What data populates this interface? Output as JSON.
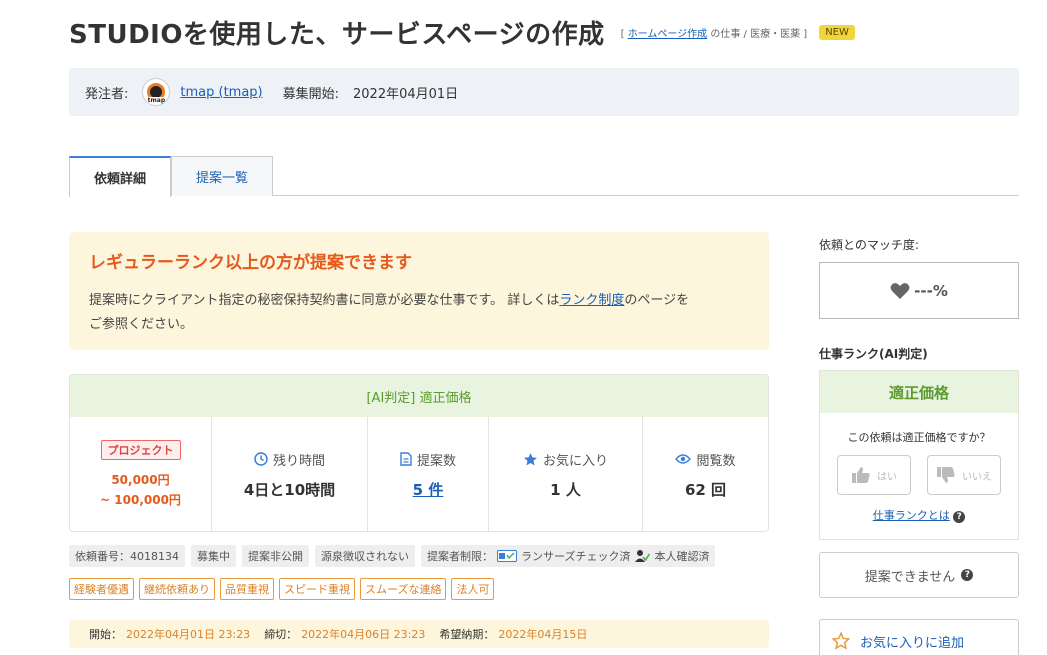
{
  "header": {
    "title": "STUDIOを使用した、サービスページの作成",
    "crumb_open": "[",
    "crumb_link": "ホームページ作成",
    "crumb_rest": "の仕事 / 医療・医薬",
    "crumb_close": "]",
    "new_badge": "NEW"
  },
  "client": {
    "label": "発注者:",
    "name": "tmap (tmap)",
    "avatar_text": "tmap",
    "recruit_label": "募集開始:",
    "recruit_date": "2022年04月01日"
  },
  "tabs": [
    {
      "label": "依頼詳細",
      "active": true
    },
    {
      "label": "提案一覧",
      "active": false
    }
  ],
  "notice": {
    "title": "レギュラーランク以上の方が提案できます",
    "body_before": "提案時にクライアント指定の秘密保持契約書に同意が必要な仕事です。 詳しくは",
    "link": "ランク制度",
    "body_after": "のページを",
    "body_line2": "ご参照ください。"
  },
  "stats": {
    "header": "[AI判定] 適正価格",
    "project_badge": "プロジェクト",
    "price_min": "50,000円",
    "price_max": "~ 100,000円",
    "remaining_label": "残り時間",
    "remaining_value": "4日と10時間",
    "proposals_label": "提案数",
    "proposals_value": "5 件",
    "favorites_label": "お気に入り",
    "favorites_value": "1 人",
    "views_label": "閲覧数",
    "views_value": "62 回"
  },
  "tags_info": {
    "job_number": "依頼番号：4018134",
    "status": "募集中",
    "proposal_visibility": "提案非公開",
    "withholding": "源泉徴収されない",
    "restriction_label": "提案者制限：",
    "restriction_check": "ランサーズチェック済",
    "restriction_id": "本人確認済"
  },
  "tags_pref": [
    "経験者優遇",
    "継続依頼あり",
    "品質重視",
    "スピード重視",
    "スムーズな連絡",
    "法人可"
  ],
  "dates": {
    "start_label": "開始：",
    "start_value": "2022年04月01日 23:23",
    "end_label": "締切：",
    "end_value": "2022年04月06日 23:23",
    "delivery_label": "希望納期：",
    "delivery_value": "2022年04月15日"
  },
  "sidebar": {
    "match_label": "依頼とのマッチ度:",
    "match_value": "---%",
    "rank_label": "仕事ランク(AI判定)",
    "rank_value": "適正価格",
    "rank_question": "この依頼は適正価格ですか？",
    "vote_yes": "はい",
    "vote_no": "いいえ",
    "rank_link": "仕事ランクとは",
    "cant_propose": "提案できません",
    "favorite_add": "お気に入りに追加"
  },
  "colors": {
    "accent_blue": "#1a5fb4",
    "warn_orange": "#e55a1c",
    "fair_green": "#5c9b2f",
    "notice_bg": "#fdf6dc"
  }
}
